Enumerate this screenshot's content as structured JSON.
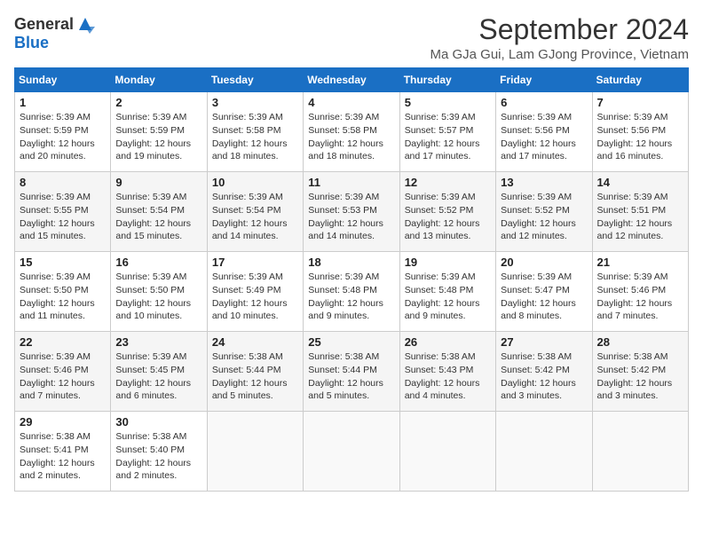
{
  "header": {
    "logo_general": "General",
    "logo_blue": "Blue",
    "month_title": "September 2024",
    "location": "Ma GJa Gui, Lam GJong Province, Vietnam"
  },
  "weekdays": [
    "Sunday",
    "Monday",
    "Tuesday",
    "Wednesday",
    "Thursday",
    "Friday",
    "Saturday"
  ],
  "days": [
    {
      "date": "1",
      "sunrise": "Sunrise: 5:39 AM",
      "sunset": "Sunset: 5:59 PM",
      "daylight": "Daylight: 12 hours and 20 minutes."
    },
    {
      "date": "2",
      "sunrise": "Sunrise: 5:39 AM",
      "sunset": "Sunset: 5:59 PM",
      "daylight": "Daylight: 12 hours and 19 minutes."
    },
    {
      "date": "3",
      "sunrise": "Sunrise: 5:39 AM",
      "sunset": "Sunset: 5:58 PM",
      "daylight": "Daylight: 12 hours and 18 minutes."
    },
    {
      "date": "4",
      "sunrise": "Sunrise: 5:39 AM",
      "sunset": "Sunset: 5:58 PM",
      "daylight": "Daylight: 12 hours and 18 minutes."
    },
    {
      "date": "5",
      "sunrise": "Sunrise: 5:39 AM",
      "sunset": "Sunset: 5:57 PM",
      "daylight": "Daylight: 12 hours and 17 minutes."
    },
    {
      "date": "6",
      "sunrise": "Sunrise: 5:39 AM",
      "sunset": "Sunset: 5:56 PM",
      "daylight": "Daylight: 12 hours and 17 minutes."
    },
    {
      "date": "7",
      "sunrise": "Sunrise: 5:39 AM",
      "sunset": "Sunset: 5:56 PM",
      "daylight": "Daylight: 12 hours and 16 minutes."
    },
    {
      "date": "8",
      "sunrise": "Sunrise: 5:39 AM",
      "sunset": "Sunset: 5:55 PM",
      "daylight": "Daylight: 12 hours and 15 minutes."
    },
    {
      "date": "9",
      "sunrise": "Sunrise: 5:39 AM",
      "sunset": "Sunset: 5:54 PM",
      "daylight": "Daylight: 12 hours and 15 minutes."
    },
    {
      "date": "10",
      "sunrise": "Sunrise: 5:39 AM",
      "sunset": "Sunset: 5:54 PM",
      "daylight": "Daylight: 12 hours and 14 minutes."
    },
    {
      "date": "11",
      "sunrise": "Sunrise: 5:39 AM",
      "sunset": "Sunset: 5:53 PM",
      "daylight": "Daylight: 12 hours and 14 minutes."
    },
    {
      "date": "12",
      "sunrise": "Sunrise: 5:39 AM",
      "sunset": "Sunset: 5:52 PM",
      "daylight": "Daylight: 12 hours and 13 minutes."
    },
    {
      "date": "13",
      "sunrise": "Sunrise: 5:39 AM",
      "sunset": "Sunset: 5:52 PM",
      "daylight": "Daylight: 12 hours and 12 minutes."
    },
    {
      "date": "14",
      "sunrise": "Sunrise: 5:39 AM",
      "sunset": "Sunset: 5:51 PM",
      "daylight": "Daylight: 12 hours and 12 minutes."
    },
    {
      "date": "15",
      "sunrise": "Sunrise: 5:39 AM",
      "sunset": "Sunset: 5:50 PM",
      "daylight": "Daylight: 12 hours and 11 minutes."
    },
    {
      "date": "16",
      "sunrise": "Sunrise: 5:39 AM",
      "sunset": "Sunset: 5:50 PM",
      "daylight": "Daylight: 12 hours and 10 minutes."
    },
    {
      "date": "17",
      "sunrise": "Sunrise: 5:39 AM",
      "sunset": "Sunset: 5:49 PM",
      "daylight": "Daylight: 12 hours and 10 minutes."
    },
    {
      "date": "18",
      "sunrise": "Sunrise: 5:39 AM",
      "sunset": "Sunset: 5:48 PM",
      "daylight": "Daylight: 12 hours and 9 minutes."
    },
    {
      "date": "19",
      "sunrise": "Sunrise: 5:39 AM",
      "sunset": "Sunset: 5:48 PM",
      "daylight": "Daylight: 12 hours and 9 minutes."
    },
    {
      "date": "20",
      "sunrise": "Sunrise: 5:39 AM",
      "sunset": "Sunset: 5:47 PM",
      "daylight": "Daylight: 12 hours and 8 minutes."
    },
    {
      "date": "21",
      "sunrise": "Sunrise: 5:39 AM",
      "sunset": "Sunset: 5:46 PM",
      "daylight": "Daylight: 12 hours and 7 minutes."
    },
    {
      "date": "22",
      "sunrise": "Sunrise: 5:39 AM",
      "sunset": "Sunset: 5:46 PM",
      "daylight": "Daylight: 12 hours and 7 minutes."
    },
    {
      "date": "23",
      "sunrise": "Sunrise: 5:39 AM",
      "sunset": "Sunset: 5:45 PM",
      "daylight": "Daylight: 12 hours and 6 minutes."
    },
    {
      "date": "24",
      "sunrise": "Sunrise: 5:38 AM",
      "sunset": "Sunset: 5:44 PM",
      "daylight": "Daylight: 12 hours and 5 minutes."
    },
    {
      "date": "25",
      "sunrise": "Sunrise: 5:38 AM",
      "sunset": "Sunset: 5:44 PM",
      "daylight": "Daylight: 12 hours and 5 minutes."
    },
    {
      "date": "26",
      "sunrise": "Sunrise: 5:38 AM",
      "sunset": "Sunset: 5:43 PM",
      "daylight": "Daylight: 12 hours and 4 minutes."
    },
    {
      "date": "27",
      "sunrise": "Sunrise: 5:38 AM",
      "sunset": "Sunset: 5:42 PM",
      "daylight": "Daylight: 12 hours and 3 minutes."
    },
    {
      "date": "28",
      "sunrise": "Sunrise: 5:38 AM",
      "sunset": "Sunset: 5:42 PM",
      "daylight": "Daylight: 12 hours and 3 minutes."
    },
    {
      "date": "29",
      "sunrise": "Sunrise: 5:38 AM",
      "sunset": "Sunset: 5:41 PM",
      "daylight": "Daylight: 12 hours and 2 minutes."
    },
    {
      "date": "30",
      "sunrise": "Sunrise: 5:38 AM",
      "sunset": "Sunset: 5:40 PM",
      "daylight": "Daylight: 12 hours and 2 minutes."
    }
  ]
}
